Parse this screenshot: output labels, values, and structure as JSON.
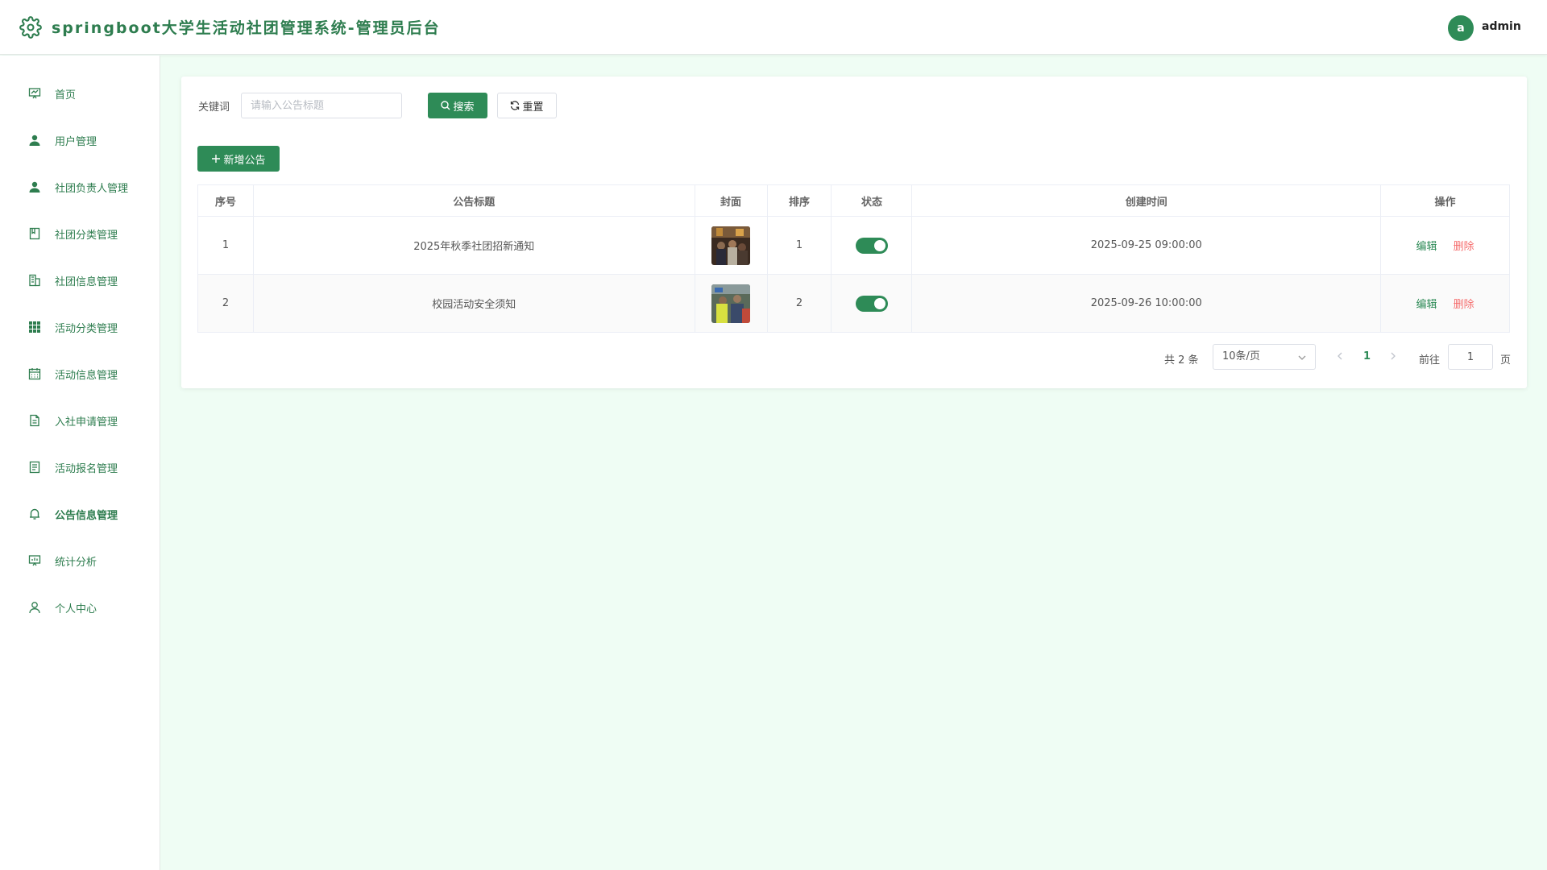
{
  "header": {
    "title": "springboot大学生活动社团管理系统-管理员后台",
    "avatar_letter": "a",
    "username": "admin",
    "logo_icon": "gear-icon"
  },
  "sidebar": {
    "items": [
      {
        "label": "首页",
        "icon": "presentation-chart-icon",
        "active": false
      },
      {
        "label": "用户管理",
        "icon": "user-solid-icon",
        "active": false
      },
      {
        "label": "社团负责人管理",
        "icon": "user-solid-icon",
        "active": false
      },
      {
        "label": "社团分类管理",
        "icon": "notebook-icon",
        "active": false
      },
      {
        "label": "社团信息管理",
        "icon": "office-building-icon",
        "active": false
      },
      {
        "label": "活动分类管理",
        "icon": "grid-icon",
        "active": false
      },
      {
        "label": "活动信息管理",
        "icon": "calendar-icon",
        "active": false
      },
      {
        "label": "入社申请管理",
        "icon": "document-icon",
        "active": false
      },
      {
        "label": "活动报名管理",
        "icon": "tickets-icon",
        "active": false
      },
      {
        "label": "公告信息管理",
        "icon": "bell-icon",
        "active": true
      },
      {
        "label": "统计分析",
        "icon": "data-board-icon",
        "active": false
      },
      {
        "label": "个人中心",
        "icon": "user-outline-icon",
        "active": false
      }
    ]
  },
  "search": {
    "label": "关键词",
    "placeholder": "请输入公告标题",
    "value": "",
    "search_button": "搜索",
    "reset_button": "重置"
  },
  "toolbar": {
    "add_button": "新增公告"
  },
  "table": {
    "columns": [
      "序号",
      "公告标题",
      "封面",
      "排序",
      "状态",
      "创建时间",
      "操作"
    ],
    "rows": [
      {
        "index": "1",
        "title": "2025年秋季社团招新通知",
        "sort": "1",
        "status": true,
        "created": "2025-09-25 09:00:00",
        "edit": "编辑",
        "delete": "删除"
      },
      {
        "index": "2",
        "title": "校园活动安全须知",
        "sort": "2",
        "status": true,
        "created": "2025-09-26 10:00:00",
        "edit": "编辑",
        "delete": "删除"
      }
    ]
  },
  "pagination": {
    "total": "共 2 条",
    "page_size": "10条/页",
    "current_page": "1",
    "goto_label": "前往",
    "goto_value": "1",
    "page_suffix": "页"
  },
  "colors": {
    "primary": "#2e8b57",
    "danger": "#f56c6c",
    "background": "#effdf4"
  }
}
